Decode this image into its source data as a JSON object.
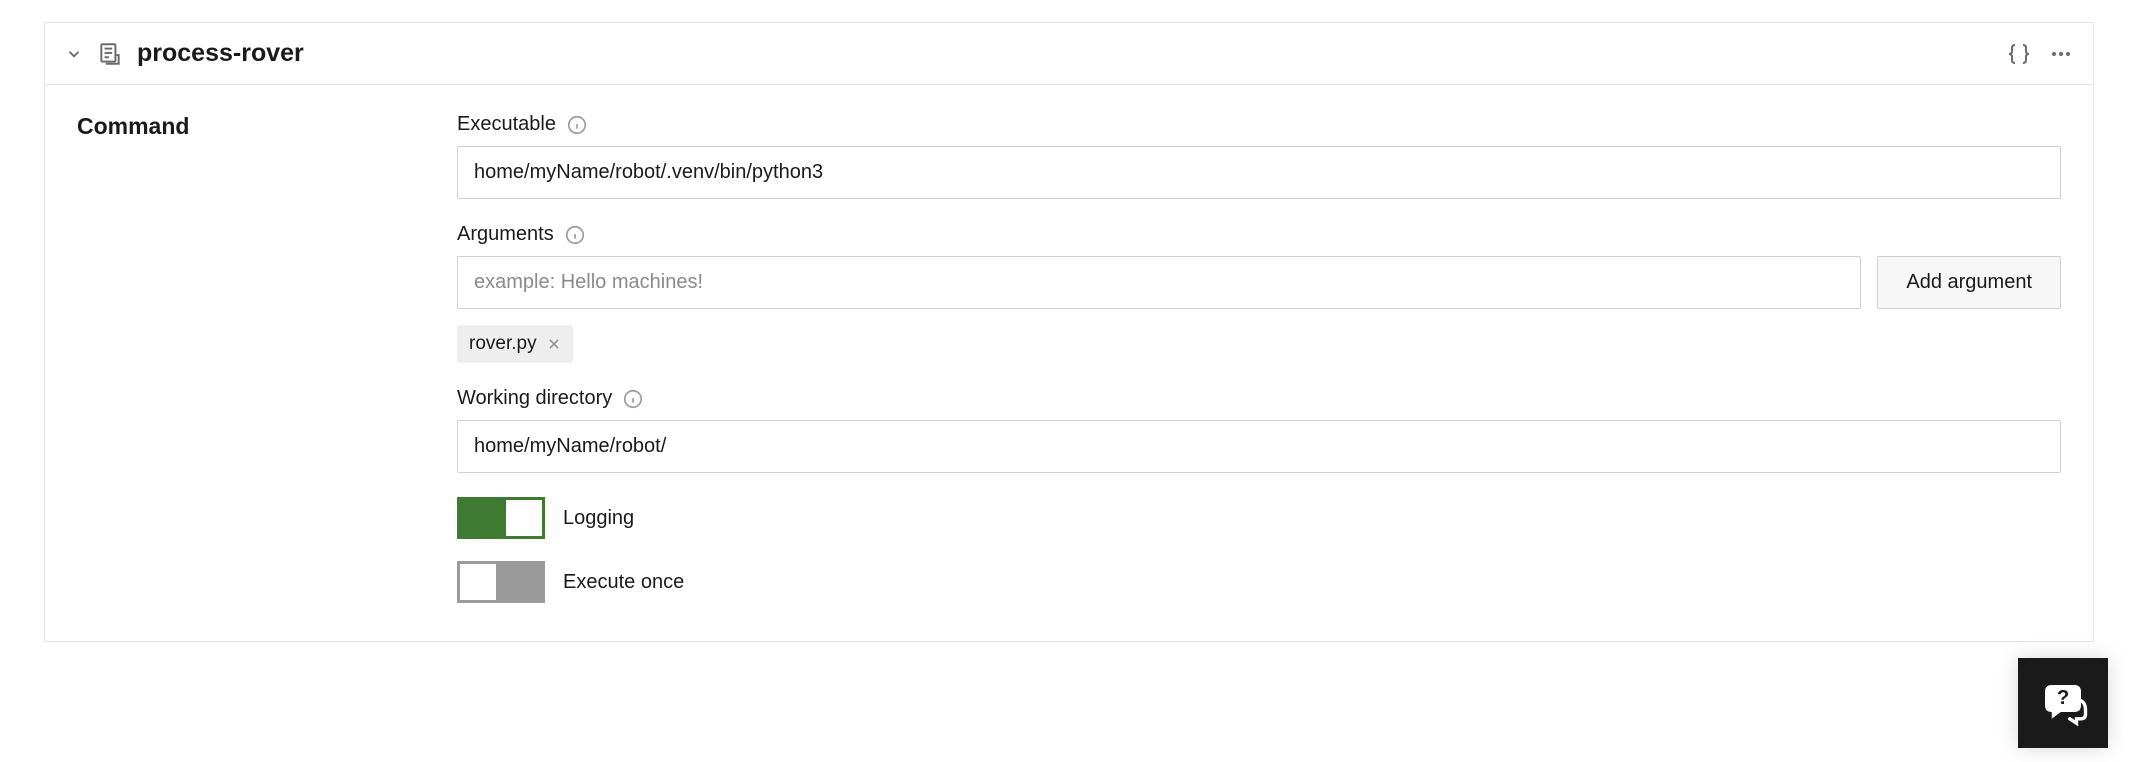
{
  "header": {
    "title": "process-rover"
  },
  "section": {
    "label": "Command"
  },
  "fields": {
    "executable": {
      "label": "Executable",
      "value": "home/myName/robot/.venv/bin/python3"
    },
    "arguments": {
      "label": "Arguments",
      "placeholder": "example: Hello machines!",
      "value": "",
      "add_button": "Add argument",
      "chips": [
        "rover.py"
      ]
    },
    "working_directory": {
      "label": "Working directory",
      "value": "home/myName/robot/"
    },
    "logging": {
      "label": "Logging",
      "enabled": true
    },
    "execute_once": {
      "label": "Execute once",
      "enabled": false
    }
  }
}
